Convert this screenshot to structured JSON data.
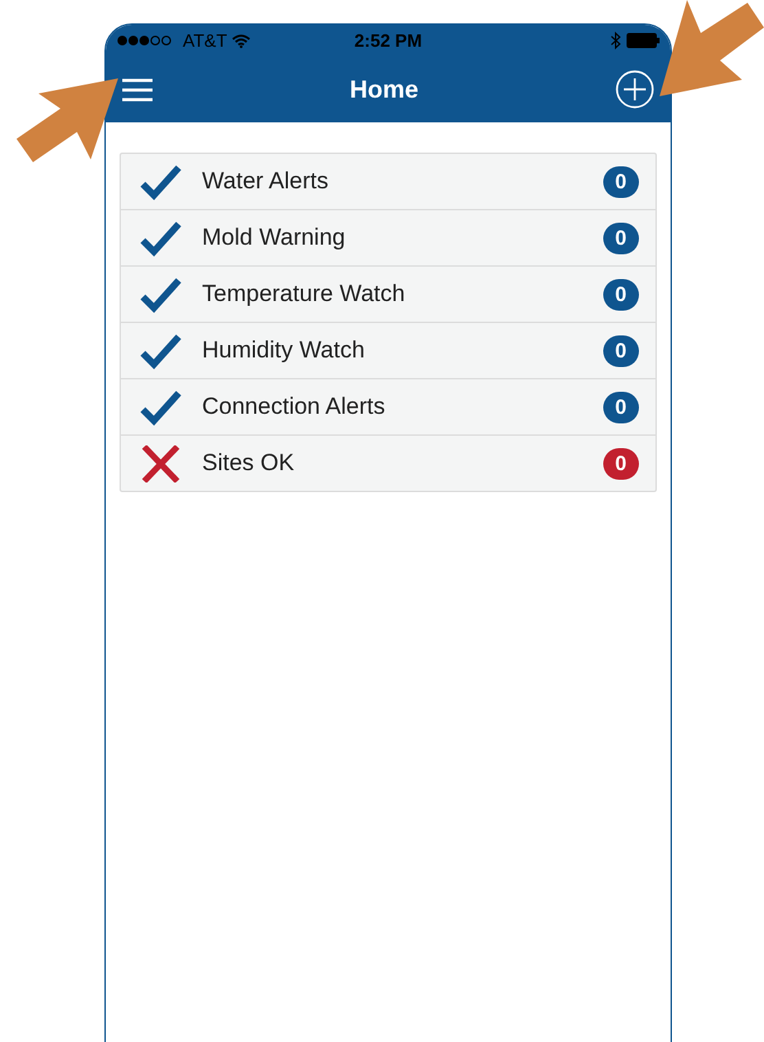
{
  "status_bar": {
    "carrier": "AT&T",
    "time": "2:52 PM"
  },
  "nav": {
    "title": "Home"
  },
  "items": [
    {
      "label": "Water Alerts",
      "ok": true,
      "count": "0"
    },
    {
      "label": "Mold Warning",
      "ok": true,
      "count": "0"
    },
    {
      "label": "Temperature Watch",
      "ok": true,
      "count": "0"
    },
    {
      "label": "Humidity Watch",
      "ok": true,
      "count": "0"
    },
    {
      "label": "Connection Alerts",
      "ok": true,
      "count": "0"
    },
    {
      "label": "Sites OK",
      "ok": false,
      "count": "0"
    }
  ]
}
